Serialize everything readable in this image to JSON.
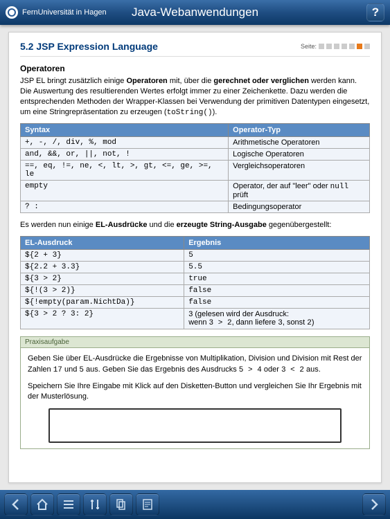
{
  "header": {
    "logo_text": "FernUniversität in Hagen",
    "title": "Java-Webanwendungen",
    "help": "?"
  },
  "page": {
    "title": "5.2 JSP Expression Language",
    "seite_label": "Seite:",
    "page_indicator": {
      "total": 7,
      "active_index": 5
    }
  },
  "section1": {
    "heading": "Operatoren",
    "para_parts": {
      "p1": "JSP EL bringt zusätzlich einige ",
      "b1": "Operatoren",
      "p2": " mit, über die ",
      "b2": "gerechnet oder verglichen",
      "p3": " werden kann. Die Auswertung des resultierenden Wertes erfolgt immer zu einer Zeichenkette. Dazu werden die entsprechenden Methoden der Wrapper-Klassen bei Verwendung der primitiven Datentypen eingesetzt, um eine Stringrepräsentation zu erzeugen (",
      "c1": "toString()",
      "p4": ")."
    }
  },
  "table1": {
    "headers": {
      "c1": "Syntax",
      "c2": "Operator-Typ"
    },
    "rows": [
      {
        "syntax": "+, -, /, div, %, mod",
        "typ": "Arithmetische Operatoren"
      },
      {
        "syntax": "and, &&, or, ||, not, !",
        "typ": "Logische Operatoren"
      },
      {
        "syntax": "==, eq, !=, ne, <, lt, >, gt, <=, ge, >=, le",
        "typ": "Vergleichsoperatoren"
      },
      {
        "syntax": "empty",
        "typ_pre": "Operator, der auf \"leer\" oder ",
        "typ_code": "null",
        "typ_post": " prüft"
      },
      {
        "syntax": "? :",
        "typ": "Bedingungsoperator"
      }
    ]
  },
  "mid_para": {
    "p1": "Es werden nun einige ",
    "b1": "EL-Ausdrücke",
    "p2": " und die ",
    "b2": "erzeugte String-Ausgabe",
    "p3": " gegenübergestellt:"
  },
  "table2": {
    "headers": {
      "c1": "EL-Ausdruck",
      "c2": "Ergebnis"
    },
    "rows": [
      {
        "expr": "${2 + 3}",
        "res": "5"
      },
      {
        "expr": "${2.2 + 3.3}",
        "res": "5.5"
      },
      {
        "expr": "${3 > 2}",
        "res": "true"
      },
      {
        "expr": "${!(3 > 2)}",
        "res": "false"
      },
      {
        "expr": "${!empty(param.NichtDa)}",
        "res": "false"
      },
      {
        "expr": "${3 > 2 ? 3: 2}",
        "res_pre": "3 (gelesen wird der Ausdruck:\nwenn ",
        "res_c1": "3 > 2",
        "res_mid": ", dann liefere ",
        "res_c2": "3",
        "res_mid2": ", sonst ",
        "res_c3": "2",
        "res_post": ")"
      }
    ]
  },
  "praxis": {
    "title": "Praxisaufgabe",
    "p1_a": "Geben Sie über EL-Ausdrücke die Ergebnisse von Multiplikation, Division und Division mit Rest der Zahlen ",
    "p1_c1": "17",
    "p1_b": " und ",
    "p1_c2": "5",
    "p1_c": " aus. Geben Sie das Ergebnis des Ausdrucks ",
    "p1_c3": "5 > 4",
    "p1_d": " oder ",
    "p1_c4": "3 < 2",
    "p1_e": " aus.",
    "p2": "Speichern Sie Ihre Eingabe mit Klick auf den Disketten-Button und vergleichen Sie Ihr Ergebnis mit der Musterlösung."
  },
  "footer": {
    "icons": [
      "prev",
      "home",
      "list",
      "tools",
      "pages",
      "notes",
      "next"
    ]
  }
}
